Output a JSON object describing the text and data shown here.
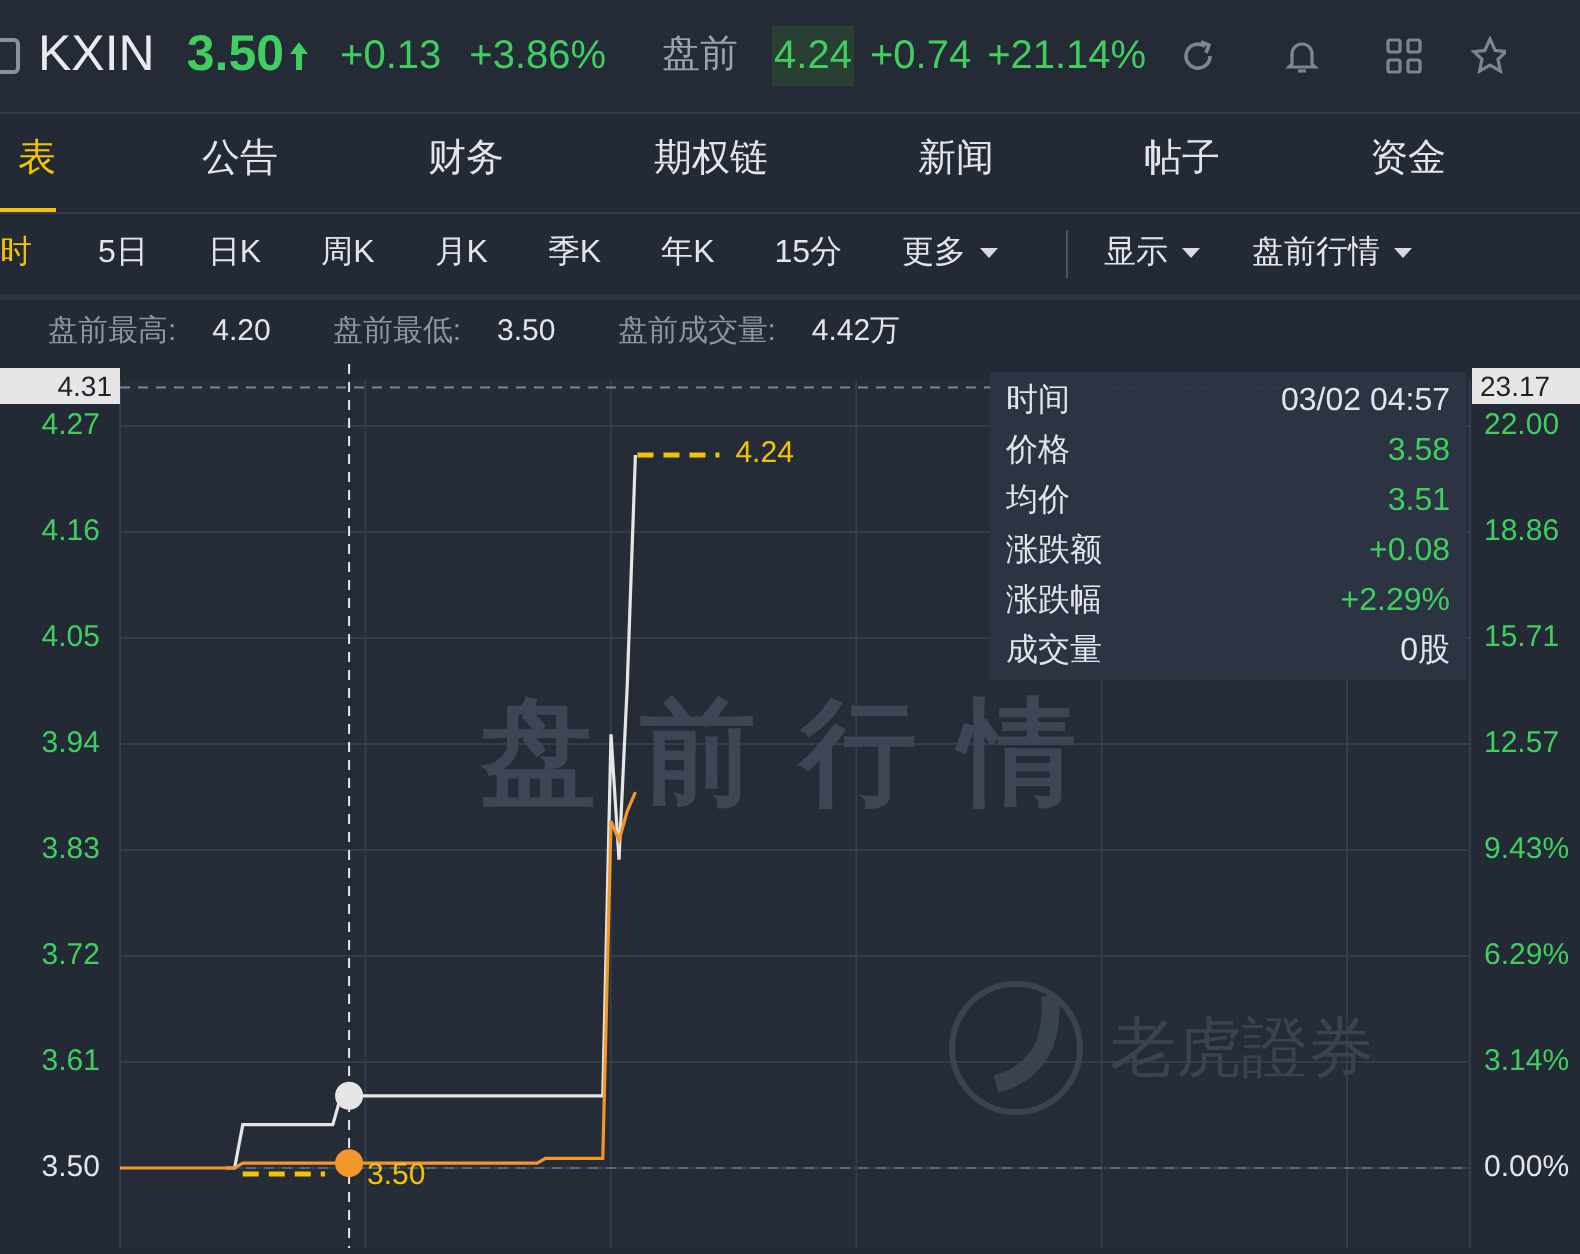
{
  "header": {
    "symbol": "KXIN",
    "price": "3.50",
    "change": "+0.13",
    "change_pct": "+3.86%",
    "session_label": "盘前",
    "session_price": "4.24",
    "session_change": "+0.74",
    "session_change_pct": "+21.14%"
  },
  "tabs": [
    {
      "label": "表",
      "selected": true
    },
    {
      "label": "公告",
      "selected": false
    },
    {
      "label": "财务",
      "selected": false
    },
    {
      "label": "期权链",
      "selected": false
    },
    {
      "label": "新闻",
      "selected": false
    },
    {
      "label": "帖子",
      "selected": false
    },
    {
      "label": "资金",
      "selected": false
    }
  ],
  "periods": [
    {
      "label": "时",
      "selected": true,
      "dropdown": false
    },
    {
      "label": "5日",
      "selected": false,
      "dropdown": false
    },
    {
      "label": "日K",
      "selected": false,
      "dropdown": false
    },
    {
      "label": "周K",
      "selected": false,
      "dropdown": false
    },
    {
      "label": "月K",
      "selected": false,
      "dropdown": false
    },
    {
      "label": "季K",
      "selected": false,
      "dropdown": false
    },
    {
      "label": "年K",
      "selected": false,
      "dropdown": false
    },
    {
      "label": "15分",
      "selected": false,
      "dropdown": false
    },
    {
      "label": "更多",
      "selected": false,
      "dropdown": true
    }
  ],
  "view_menus": [
    {
      "label": "显示"
    },
    {
      "label": "盘前行情"
    }
  ],
  "stats": [
    {
      "label": "盘前最高:",
      "value": "4.20"
    },
    {
      "label": "盘前最低:",
      "value": "3.50"
    },
    {
      "label": "盘前成交量:",
      "value": "4.42万"
    }
  ],
  "chart": {
    "top_price_label": "4.31",
    "top_pct_label": "23.17",
    "watermark": "盘前行情",
    "brand_watermark": "老虎證券",
    "high_marker": "4.24",
    "low_marker": "3.50",
    "right_labels": [
      "22.00",
      "18.86",
      "15.71",
      "12.57",
      "9.43%",
      "6.29%",
      "3.14%",
      "0.00%"
    ],
    "tooltip": [
      {
        "kind": "field",
        "label": "时间",
        "value": "03/02 04:57",
        "up": false
      },
      {
        "kind": "series",
        "value": "3.58",
        "up": true
      },
      {
        "kind": "series",
        "value": "3.51",
        "up": true
      },
      {
        "kind": "field",
        "label": "涨跌额",
        "value": "+0.08",
        "up": true
      },
      {
        "kind": "field",
        "label": "涨跌幅",
        "value": "+2.29%",
        "up": true
      },
      {
        "kind": "field",
        "label": "成交量",
        "value": "0股",
        "up": false
      }
    ],
    "chart_data": {
      "type": "line",
      "grid": true,
      "ylim": [
        3.5,
        4.31
      ],
      "yticks": [
        {
          "value": 3.5,
          "label": "3.50"
        },
        {
          "value": 3.61,
          "label": "3.61"
        },
        {
          "value": 3.72,
          "label": "3.72"
        },
        {
          "value": 3.83,
          "label": "3.83"
        },
        {
          "value": 3.94,
          "label": "3.94"
        },
        {
          "value": 4.05,
          "label": "4.05"
        },
        {
          "value": 4.16,
          "label": "4.16"
        },
        {
          "value": 4.27,
          "label": "4.27"
        }
      ],
      "categories": [
        null,
        null,
        null,
        null,
        null,
        null,
        null,
        null,
        null,
        null,
        null,
        null,
        null,
        null,
        null,
        null,
        null,
        null,
        null,
        null,
        null,
        null,
        null,
        null,
        null,
        null,
        null,
        null,
        null,
        null,
        null,
        null,
        null,
        null,
        null,
        null,
        null,
        null,
        null,
        null,
        null,
        null,
        null,
        null,
        null,
        null,
        null,
        null,
        null,
        null,
        null,
        null,
        null,
        null,
        null,
        null,
        null,
        null,
        null,
        null,
        null,
        null,
        null,
        null,
        null,
        null,
        null,
        null,
        null,
        null,
        null,
        null,
        null,
        null,
        null,
        null,
        null,
        null,
        null,
        null,
        null,
        null,
        null,
        null,
        null,
        null,
        null,
        null,
        null,
        null,
        null,
        null,
        null,
        null,
        null,
        null,
        null,
        null,
        null,
        null,
        null,
        null,
        null,
        null,
        null,
        null,
        null,
        null,
        null,
        null,
        null,
        null,
        null,
        null,
        null,
        null,
        null,
        null,
        null,
        null,
        null,
        null,
        null,
        null,
        null,
        null,
        null,
        null,
        null,
        null,
        null,
        null,
        null,
        null,
        null,
        null,
        null,
        null,
        null,
        null,
        null,
        null,
        null,
        null,
        null,
        null,
        null,
        null,
        null,
        null,
        null,
        null,
        null,
        null,
        null,
        null,
        null,
        null,
        null,
        null,
        null,
        null,
        null,
        null,
        null
      ],
      "series": [
        {
          "name": "价格",
          "color": "#e6e6e6",
          "values": [
            null,
            null,
            null,
            null,
            null,
            null,
            null,
            null,
            null,
            null,
            null,
            null,
            null,
            3.5,
            3.5,
            3.545,
            3.545,
            3.545,
            3.545,
            3.545,
            3.545,
            3.545,
            3.545,
            3.545,
            3.545,
            3.545,
            3.545,
            3.575,
            3.575,
            3.575,
            3.575,
            3.575,
            3.575,
            3.575,
            3.575,
            3.575,
            3.575,
            3.575,
            3.575,
            3.575,
            3.575,
            3.575,
            3.575,
            3.575,
            3.575,
            3.575,
            3.575,
            3.575,
            3.575,
            3.575,
            3.575,
            3.575,
            3.575,
            3.575,
            3.575,
            3.575,
            3.575,
            3.575,
            3.575,
            3.575,
            3.95,
            3.82,
            4.0,
            4.24,
            null,
            null,
            null,
            null,
            null,
            null,
            null,
            null,
            null,
            null,
            null,
            null,
            null,
            null,
            null,
            null,
            null,
            null,
            null,
            null,
            null,
            null,
            null,
            null,
            null,
            null,
            null,
            null,
            null,
            null,
            null,
            null,
            null,
            null,
            null,
            null,
            null,
            null,
            null,
            null,
            null,
            null,
            null,
            null,
            null,
            null,
            null,
            null,
            null,
            null,
            null,
            null,
            null,
            null,
            null,
            null,
            null,
            null,
            null,
            null,
            null,
            null,
            null,
            null,
            null,
            null,
            null,
            null,
            null,
            null,
            null,
            null,
            null,
            null,
            null,
            null,
            null,
            null,
            null,
            null,
            null,
            null,
            null,
            null,
            null,
            null,
            null,
            null,
            null,
            null,
            null,
            null,
            null,
            null,
            null,
            null,
            null,
            null,
            null,
            null,
            null
          ]
        },
        {
          "name": "均价",
          "color": "#f5962a",
          "values": [
            3.5,
            3.5,
            3.5,
            3.5,
            3.5,
            3.5,
            3.5,
            3.5,
            3.5,
            3.5,
            3.5,
            3.5,
            3.5,
            3.5,
            3.5,
            3.505,
            3.505,
            3.505,
            3.505,
            3.505,
            3.505,
            3.505,
            3.505,
            3.505,
            3.505,
            3.505,
            3.505,
            3.505,
            3.505,
            3.505,
            3.505,
            3.505,
            3.505,
            3.505,
            3.505,
            3.505,
            3.505,
            3.505,
            3.505,
            3.505,
            3.505,
            3.505,
            3.505,
            3.505,
            3.505,
            3.505,
            3.505,
            3.505,
            3.505,
            3.505,
            3.505,
            3.505,
            3.51,
            3.51,
            3.51,
            3.51,
            3.51,
            3.51,
            3.51,
            3.51,
            3.86,
            3.84,
            3.87,
            3.89,
            null,
            null,
            null,
            null,
            null,
            null,
            null,
            null,
            null,
            null,
            null,
            null,
            null,
            null,
            null,
            null,
            null,
            null,
            null,
            null,
            null,
            null,
            null,
            null,
            null,
            null,
            null,
            null,
            null,
            null,
            null,
            null,
            null,
            null,
            null,
            null,
            null,
            null,
            null,
            null,
            null,
            null,
            null,
            null,
            null,
            null,
            null,
            null,
            null,
            null,
            null,
            null,
            null,
            null,
            null,
            null,
            null,
            null,
            null,
            null,
            null,
            null,
            null,
            null,
            null,
            null,
            null,
            null,
            null,
            null,
            null,
            null,
            null,
            null,
            null,
            null,
            null,
            null,
            null,
            null,
            null,
            null,
            null,
            null,
            null,
            null,
            null,
            null,
            null,
            null,
            null,
            null,
            null,
            null,
            null,
            null,
            null,
            null,
            null,
            null,
            null
          ]
        }
      ]
    }
  }
}
